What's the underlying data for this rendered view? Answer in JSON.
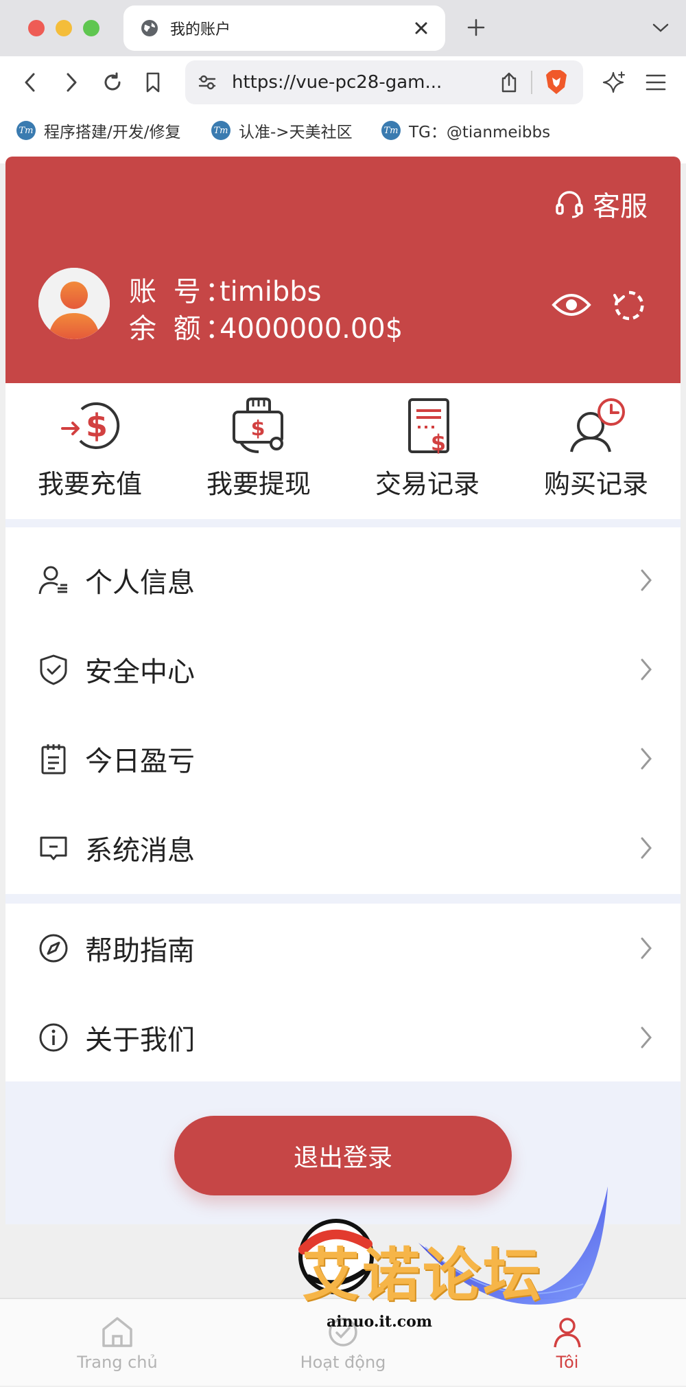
{
  "browser": {
    "tab_title": "我的账户",
    "url": "https://vue-pc28-gam...",
    "bookmarks": [
      "程序搭建/开发/修复",
      "认准->天美社区",
      "TG：@tianmeibbs"
    ],
    "bookmark_icon_text": "Tm",
    "icons": [
      "globe-icon",
      "close-icon",
      "plus-icon",
      "chevron-down-icon",
      "back-icon",
      "forward-icon",
      "reload-icon",
      "bookmark-icon",
      "site-settings-icon",
      "share-icon",
      "brave-shield-icon",
      "leo-ai-icon",
      "menu-icon"
    ]
  },
  "header": {
    "service_label": "客服",
    "account_label": "账 号：",
    "account_value": "timibbs",
    "balance_label": "余 额：",
    "balance_value": "4000000.00$",
    "accent_color": "#c64646"
  },
  "quick_actions": [
    {
      "label": "我要充值",
      "icon": "deposit-icon"
    },
    {
      "label": "我要提现",
      "icon": "withdraw-icon"
    },
    {
      "label": "交易记录",
      "icon": "transaction-record-icon"
    },
    {
      "label": "购买记录",
      "icon": "purchase-record-icon"
    }
  ],
  "menu_group_1": [
    {
      "label": "个人信息",
      "icon": "user-info-icon"
    },
    {
      "label": "安全中心",
      "icon": "shield-icon"
    },
    {
      "label": "今日盈亏",
      "icon": "clipboard-icon"
    },
    {
      "label": "系统消息",
      "icon": "message-icon"
    }
  ],
  "menu_group_2": [
    {
      "label": "帮助指南",
      "icon": "compass-icon"
    },
    {
      "label": "关于我们",
      "icon": "info-icon"
    }
  ],
  "logout_label": "退出登录",
  "bottom_nav": [
    {
      "label": "Trang chủ",
      "icon": "home-icon",
      "active": false
    },
    {
      "label": "Hoạt động",
      "icon": "activity-icon",
      "active": false
    },
    {
      "label": "Tôi",
      "icon": "user-icon",
      "active": true
    }
  ],
  "watermark": {
    "text": "艾诺论坛",
    "url": "ainuo.it.com"
  }
}
